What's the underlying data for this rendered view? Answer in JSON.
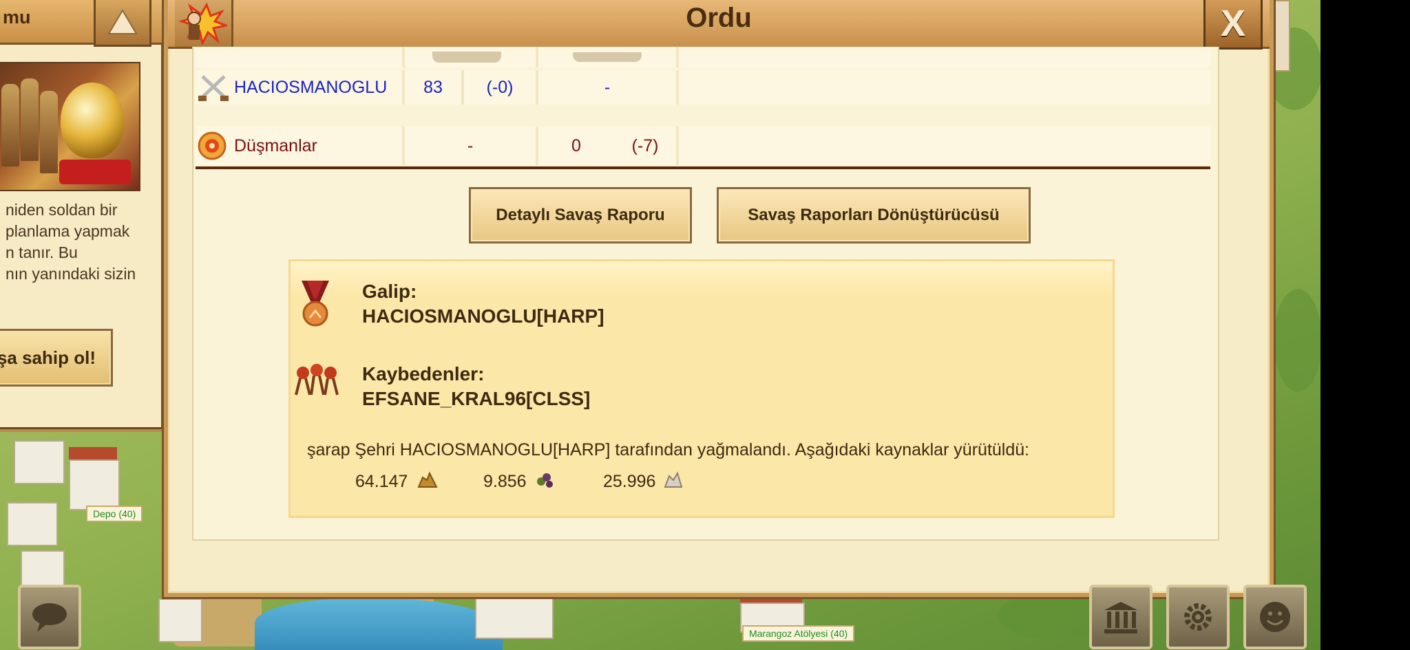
{
  "modal": {
    "title": "Ordu",
    "close_label": "X"
  },
  "side_panel": {
    "title": "mu",
    "text_lines": [
      "niden soldan bir",
      "planlama yapmak",
      "n tanır. Bu",
      "nın yanındaki sizin"
    ],
    "cta_label": "şa sahip ol!"
  },
  "table": {
    "attacker": {
      "name": "HACIOSMANOGLU",
      "value": "83",
      "change": "(-0)",
      "loss": "-"
    },
    "enemies": {
      "name": "Düşmanlar",
      "value": "-",
      "count": "0",
      "change": "(-7)"
    }
  },
  "buttons": {
    "detailed_report": "Detaylı Savaş Raporu",
    "converter": "Savaş Raporları Dönüştürücüsü"
  },
  "result": {
    "winner_label": "Galip:",
    "winner_name": "HACIOSMANOGLU[HARP]",
    "losers_label": "Kaybedenler:",
    "losers_name": "EFSANE_KRAL96[CLSS]",
    "summary": "şarap Şehri HACIOSMANOGLU[HARP] tarafından yağmalandı. Aşağıdaki kaynaklar yürütüldü:",
    "resources": [
      {
        "amount": "64.147",
        "icon": "gold-icon"
      },
      {
        "amount": "9.856",
        "icon": "wine-icon"
      },
      {
        "amount": "25.996",
        "icon": "marble-icon"
      }
    ]
  },
  "map_labels": {
    "depo": "Depo (40)",
    "marangoz": "Marangoz Atölyesi (40)"
  },
  "colors": {
    "link_blue": "#1a22c8",
    "enemy_red": "#7a1010",
    "label_green": "#1f8a22"
  }
}
